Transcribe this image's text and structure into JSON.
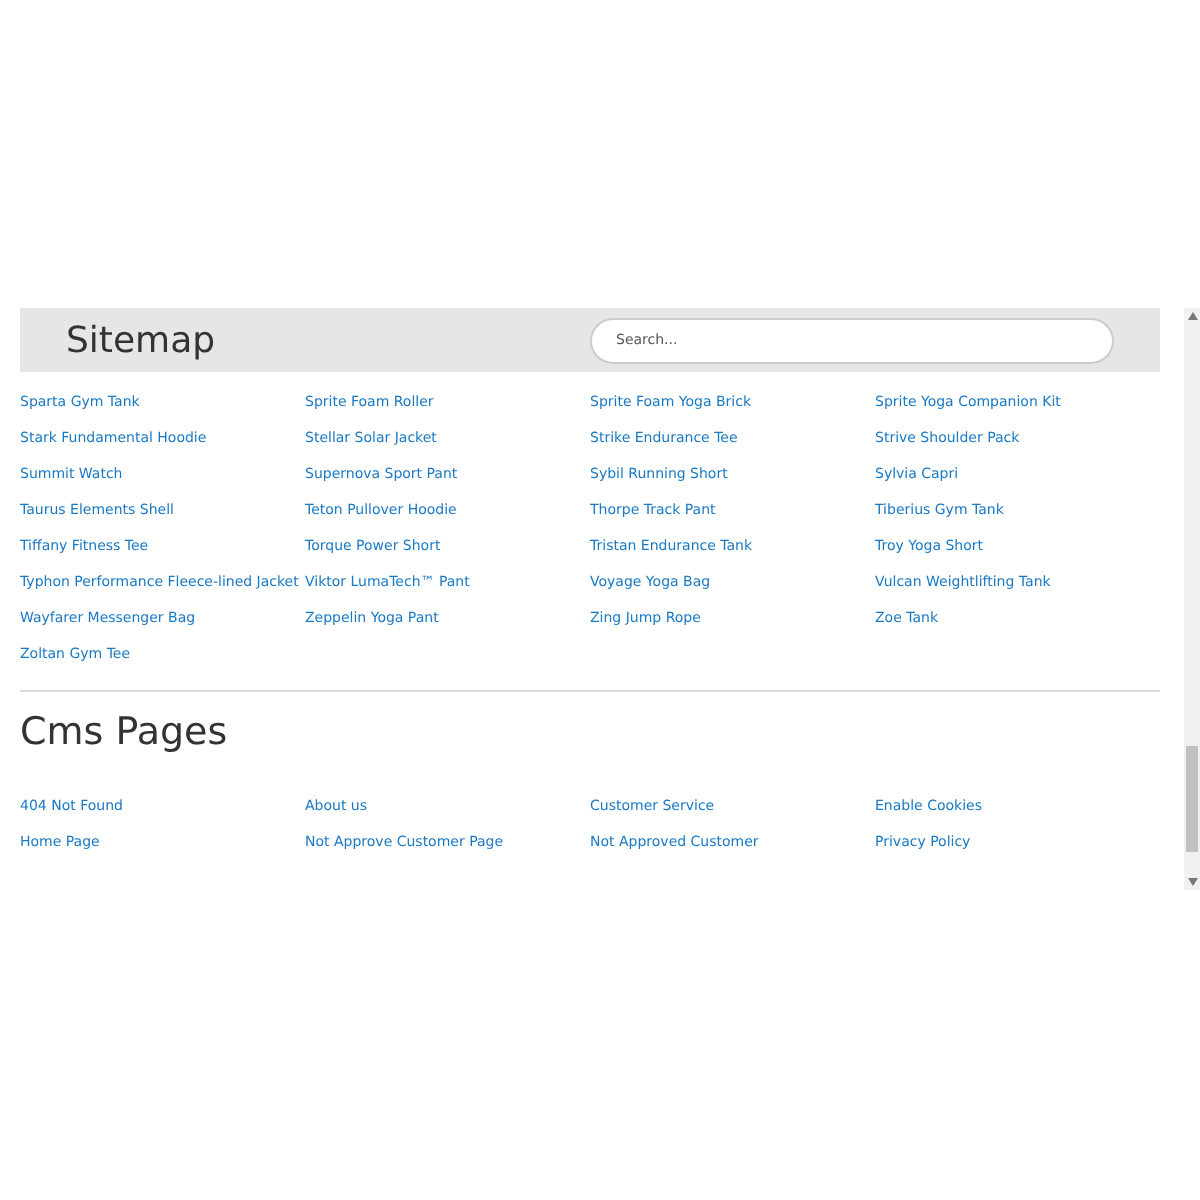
{
  "header": {
    "title": "Sitemap",
    "search": {
      "placeholder": "Search..."
    }
  },
  "products": [
    "Sparta Gym Tank",
    "Sprite Foam Roller",
    "Sprite Foam Yoga Brick",
    "Sprite Yoga Companion Kit",
    "Stark Fundamental Hoodie",
    "Stellar Solar Jacket",
    "Strike Endurance Tee",
    "Strive Shoulder Pack",
    "Summit Watch",
    "Supernova Sport Pant",
    "Sybil Running Short",
    "Sylvia Capri",
    "Taurus Elements Shell",
    "Teton Pullover Hoodie",
    "Thorpe Track Pant",
    "Tiberius Gym Tank",
    "Tiffany Fitness Tee",
    "Torque Power Short",
    "Tristan Endurance Tank",
    "Troy Yoga Short",
    "Typhon Performance Fleece-lined Jacket",
    "Viktor LumaTech™ Pant",
    "Voyage Yoga Bag",
    "Vulcan Weightlifting Tank",
    "Wayfarer Messenger Bag",
    "Zeppelin Yoga Pant",
    "Zing Jump Rope",
    "Zoe Tank",
    "Zoltan Gym Tee"
  ],
  "cms": {
    "title": "Cms Pages",
    "links": [
      "404 Not Found",
      "About us",
      "Customer Service",
      "Enable Cookies",
      "Home Page",
      "Not Approve Customer Page",
      "Not Approved Customer",
      "Privacy Policy"
    ]
  }
}
